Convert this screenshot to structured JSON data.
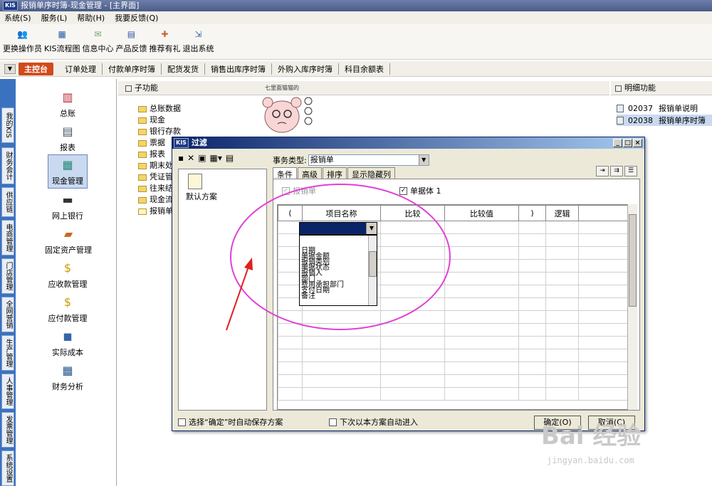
{
  "window": {
    "title": "报销单序时簿-现金管理 - [主界面]"
  },
  "menu": {
    "items": [
      "系统(S)",
      "服务(L)",
      "帮助(H)",
      "我要反馈(Q)"
    ]
  },
  "toolbar": {
    "items": [
      "更换操作员",
      "KIS流程图",
      "信息中心",
      "产品反馈",
      "推荐有礼",
      "退出系统"
    ]
  },
  "nav": {
    "main": "主控台",
    "items": [
      "订单处理",
      "付款单序时簿",
      "配货发货",
      "销售出库序时簿",
      "外购入库序时簿",
      "科目余额表"
    ]
  },
  "left_tabs": [
    "我的KIS",
    "财务会计",
    "供应链",
    "电商管理",
    "门店管理",
    "全网营销",
    "生产管理",
    "人事管理",
    "发票管理",
    "系统设置"
  ],
  "modules": [
    "总账",
    "报表",
    "现金管理",
    "网上银行",
    "固定资产管理",
    "应收款管理",
    "应付款管理",
    "实际成本",
    "财务分析"
  ],
  "sub_header": "子功能",
  "right_header": "明细功能",
  "tree": [
    "总账数据",
    "现金",
    "银行存款",
    "票据",
    "报表",
    "期末处",
    "凭证管",
    "往来结",
    "现金流",
    "报销单"
  ],
  "right_items": [
    {
      "code": "02037",
      "name": "报销单说明"
    },
    {
      "code": "02038",
      "name": "报销单序时簿"
    }
  ],
  "sticker": {
    "text": "七里面猫猫的"
  },
  "dialog": {
    "title": "过滤",
    "plan_label": "默认方案",
    "type_label": "事务类型:",
    "type_value": "报销单",
    "tabs": [
      "条件",
      "高级",
      "排序",
      "显示隐藏列"
    ],
    "check_bill": "报销单",
    "check_body": "单据体 1",
    "columns": [
      "(",
      "项目名称",
      "比较",
      "比较值",
      ")",
      "逻辑"
    ],
    "dropdown_items": [
      "日期",
      "单据金额",
      "报销类别",
      "单据状态",
      "报销人",
      "部门",
      "费用承担部门",
      "支付日期",
      "备注"
    ],
    "auto_save": "选择“确定”时自动保存方案",
    "auto_enter": "下次以本方案自动进入",
    "ok": "确定(O)",
    "cancel": "取消(C)"
  },
  "watermark": {
    "brand": "Bai 经验",
    "url": "jingyan.baidu.com"
  },
  "colors": {
    "accent": "#d04a1c",
    "annotation": "#e040d8",
    "title_blue": "#0a246a"
  }
}
